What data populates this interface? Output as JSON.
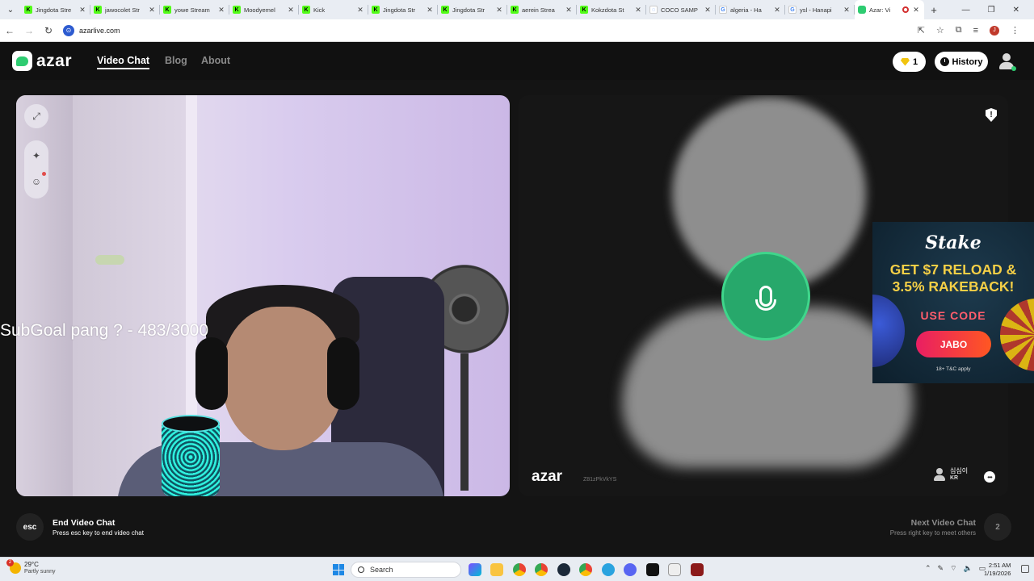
{
  "browser": {
    "tabs": [
      {
        "title": "Jingdota Stre",
        "favicon": "kick"
      },
      {
        "title": "jawocolet Str",
        "favicon": "kick"
      },
      {
        "title": "yowe Stream",
        "favicon": "kick"
      },
      {
        "title": "Moodyemel",
        "favicon": "kick"
      },
      {
        "title": "Kick",
        "favicon": "kick"
      },
      {
        "title": "Jingdota Str",
        "favicon": "kick"
      },
      {
        "title": "Jingdota Str",
        "favicon": "kick"
      },
      {
        "title": "aerein Strea",
        "favicon": "kick"
      },
      {
        "title": "Kokzdota St",
        "favicon": "kick"
      },
      {
        "title": "COCO SAMP",
        "favicon": "page"
      },
      {
        "title": "algeria - Ha",
        "favicon": "google"
      },
      {
        "title": "ysl - Hanapi",
        "favicon": "google"
      },
      {
        "title": "Azar: Vi",
        "favicon": "azar",
        "active": true
      }
    ],
    "new_tab": "+",
    "url": "azarlive.com"
  },
  "site": {
    "logo": "azar",
    "nav": [
      "Video Chat",
      "Blog",
      "About"
    ],
    "gems_count": "1",
    "history_label": "History"
  },
  "local_video": {
    "overlay_text": "SubGoal pang ? - 483/3000"
  },
  "remote_video": {
    "logo": "azar",
    "user_id": "Z81zPkVkYS",
    "peer_name": "심심이",
    "peer_country": "KR"
  },
  "ad": {
    "brand": "Stake",
    "headline_line1": "GET $7 RELOAD &",
    "headline_line2": "3.5% RAKEBACK!",
    "code_label": "USE CODE",
    "code": "JABO",
    "terms": "18+  T&C apply"
  },
  "footer": {
    "esc_label": "esc",
    "end_title": "End Video Chat",
    "end_sub": "Press esc key to end video chat",
    "next_title": "Next Video Chat",
    "next_sub": "Press right key to meet others",
    "next_key": "2"
  },
  "taskbar": {
    "weather_badge": "2",
    "weather_temp": "29°C",
    "weather_desc": "Partly sunny",
    "search_placeholder": "Search",
    "time": "2:51 AM",
    "date": "1/19/2026"
  }
}
